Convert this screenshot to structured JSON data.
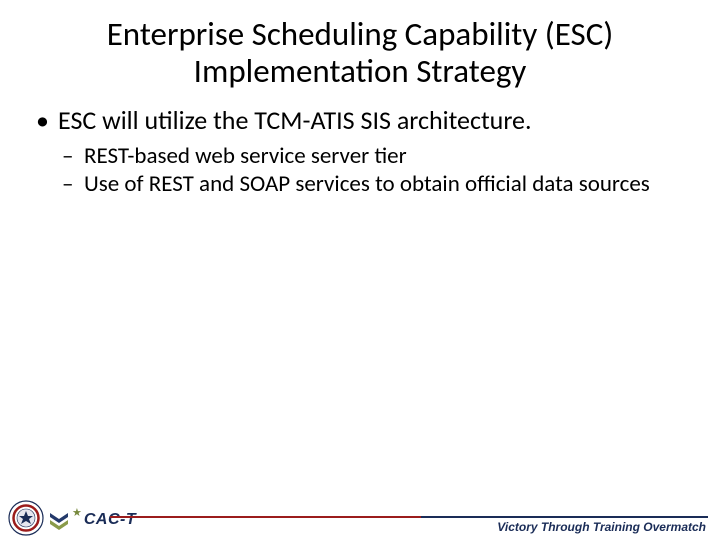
{
  "title_line1": "Enterprise Scheduling Capability (ESC)",
  "title_line2": "Implementation Strategy",
  "bullets": {
    "item0": {
      "text": "ESC will utilize the TCM-ATIS SIS architecture.",
      "sub": {
        "s0": "REST-based web service server tier",
        "s1": "Use of REST and SOAP services to obtain official data sources"
      }
    }
  },
  "footer": {
    "brand": "CAC-T",
    "motto": "Victory Through Training Overmatch"
  }
}
